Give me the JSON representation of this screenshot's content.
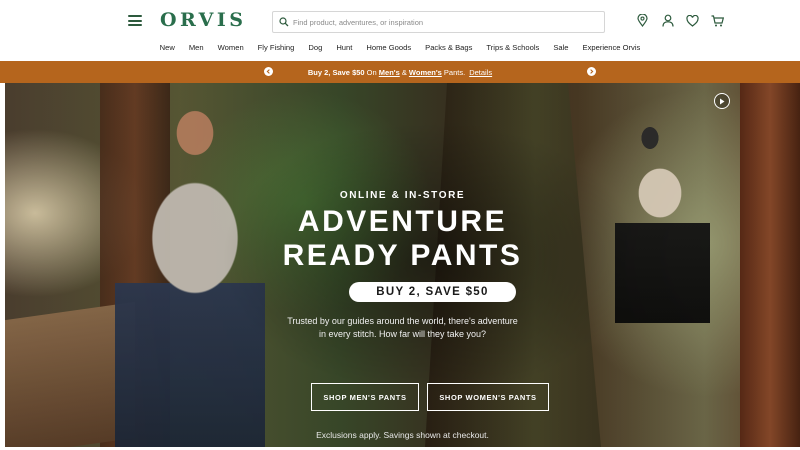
{
  "brand": {
    "logo_text": "ORVIS",
    "accent": "#2a6e4c",
    "promo_bg": "#b5651d"
  },
  "header": {
    "menu_icon": "hamburger-menu-icon",
    "search": {
      "placeholder": "Find product, adventures, or inspiration",
      "value": "",
      "icon": "search-icon"
    },
    "icons": [
      "location-pin-icon",
      "account-icon",
      "wishlist-heart-icon",
      "cart-icon"
    ]
  },
  "nav": {
    "items": [
      "New",
      "Men",
      "Women",
      "Fly Fishing",
      "Dog",
      "Hunt",
      "Home Goods",
      "Packs & Bags",
      "Trips & Schools",
      "Sale",
      "Experience Orvis"
    ]
  },
  "promo": {
    "lead": "Buy 2, Save $50",
    "mid": " On ",
    "men": "Men's",
    "amp": " & ",
    "women": "Women's",
    "tail": " Pants.",
    "details": "Details",
    "prev_icon": "chevron-left-icon",
    "next_icon": "chevron-right-icon"
  },
  "hero": {
    "eyebrow": "ONLINE & IN-STORE",
    "headline_line1": "ADVENTURE",
    "headline_line2": "READY PANTS",
    "offer": "BUY 2, SAVE $50",
    "desc_line1": "Trusted by our guides around the world, there's adventure",
    "desc_line2": "in every stitch. How far will they take you?",
    "cta_men": "SHOP MEN'S PANTS",
    "cta_women": "SHOP WOMEN'S PANTS",
    "fineprint": "Exclusions apply. Savings shown at checkout.",
    "play_icon": "play-icon"
  }
}
